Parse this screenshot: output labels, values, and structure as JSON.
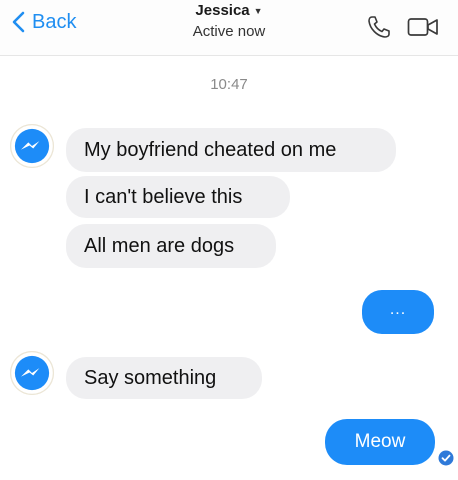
{
  "header": {
    "back_label": "Back",
    "contact_name": "Jessica",
    "status": "Active now"
  },
  "timestamp": "10:47",
  "messages": [
    {
      "sender": "Jessica",
      "direction": "incoming",
      "text": "My boyfriend cheated on me"
    },
    {
      "sender": "Jessica",
      "direction": "incoming",
      "text": "I can't believe this"
    },
    {
      "sender": "Jessica",
      "direction": "incoming",
      "text": "All men are dogs"
    },
    {
      "sender": "me",
      "direction": "outgoing",
      "text": "..."
    },
    {
      "sender": "Jessica",
      "direction": "incoming",
      "text": "Say something"
    },
    {
      "sender": "me",
      "direction": "outgoing",
      "text": "Meow"
    }
  ],
  "icons": {
    "back": "chevron-left-icon",
    "caret": "caret-down-icon",
    "call": "phone-icon",
    "video": "video-camera-icon",
    "messenger_badge": "messenger-icon",
    "seen": "check-circle-icon"
  },
  "colors": {
    "accent": "#1d8cf8",
    "incoming_bubble": "#efeff1",
    "timestamp": "#8a8a8a"
  }
}
